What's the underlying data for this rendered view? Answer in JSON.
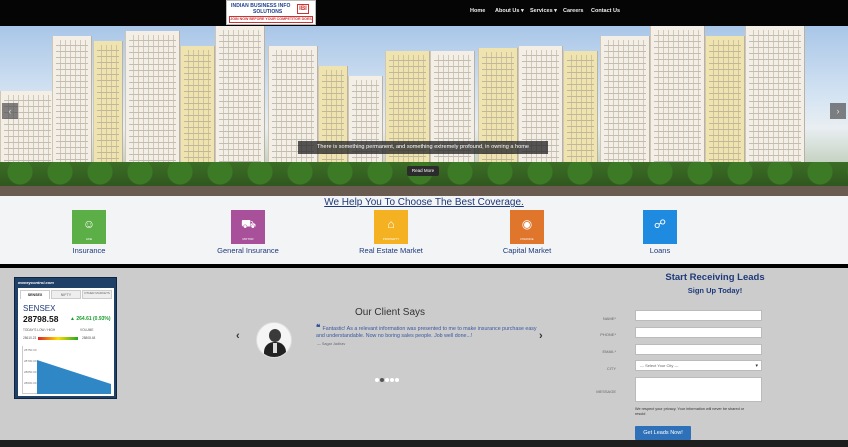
{
  "logo": {
    "line1": "INDIAN BUSINESS INFO",
    "line2": "SOLUTIONS",
    "tagline": "JOIN NOW BEFORE YOUR COMPETITOR DOES",
    "mark": "IBI"
  },
  "nav": {
    "items": [
      {
        "label": "Home"
      },
      {
        "label": "About Us ▾"
      },
      {
        "label": "Services ▾"
      },
      {
        "label": "Careers"
      },
      {
        "label": "Contact Us"
      }
    ]
  },
  "hero": {
    "caption": "There is something permanent, and something extremely profound, in owning a home",
    "read_more": "Read More",
    "prev_icon": "‹",
    "next_icon": "›"
  },
  "coverage": {
    "title": "We Help You To Choose The Best Coverage.",
    "services": [
      {
        "label": "Insurance",
        "sub": "LIFE",
        "color": "#5cae47",
        "icon": "family-icon"
      },
      {
        "label": "General Insurance",
        "sub": "MOTOR",
        "color": "#a8519a",
        "icon": "car-icon"
      },
      {
        "label": "Real Estate Market",
        "sub": "PROPERTY",
        "color": "#f4b223",
        "icon": "house-icon"
      },
      {
        "label": "Capital Market",
        "sub": "FINANCE",
        "color": "#e0752c",
        "icon": "coins-icon"
      },
      {
        "label": "Loans",
        "sub": "",
        "color": "#1f8be0",
        "icon": "hand-money-icon"
      }
    ]
  },
  "sensex": {
    "header": "moneycontrol.com",
    "tabs": [
      "SENSEX",
      "NIFTY",
      "OTHER MARKETS"
    ],
    "name": "SENSEX",
    "value": "28798.58",
    "change": "▲ 264.61 (0.93%)",
    "todays_low_label": "TODAY'S LOW / HIGH",
    "volume_label": "VOLUME",
    "low": "28610.23",
    "high": "28808.48",
    "axis": [
      "28750.00",
      "28700.00",
      "28650.00",
      "28600.00"
    ]
  },
  "clients": {
    "title": "Our Client Says",
    "quote": "Fantastic! As a relevant information was presented to me to make insurance purchase easy and understandable. Now no boring sales people. Job well done...!",
    "author": "— Sagar Jadhav",
    "slide_dots": 5,
    "active_dot": 1
  },
  "form": {
    "title": "Start Receiving Leads",
    "subtitle": "Sign Up Today!",
    "labels": {
      "name": "NAME*",
      "phone": "PHONE*",
      "email": "EMAIL*",
      "city": "CITY",
      "message": "MESSAGE"
    },
    "city_placeholder": "--- Select Your City ---",
    "privacy": "We respect your privacy. Your information will never be shared or resold",
    "privacy_link": "resold",
    "submit": "Get Leads Now!"
  }
}
